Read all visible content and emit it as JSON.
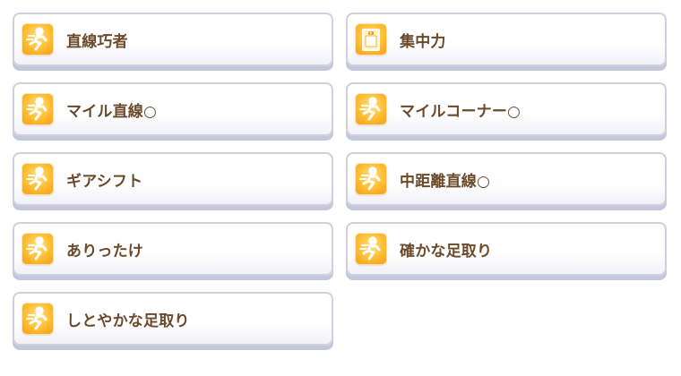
{
  "skills": [
    {
      "label": "直線巧者",
      "icon": "runner-speed-icon"
    },
    {
      "label": "集中力",
      "icon": "starting-gate-icon"
    },
    {
      "label": "マイル直線○",
      "icon": "runner-speed-icon"
    },
    {
      "label": "マイルコーナー○",
      "icon": "runner-speed-icon"
    },
    {
      "label": "ギアシフト",
      "icon": "runner-speed-icon"
    },
    {
      "label": "中距離直線○",
      "icon": "runner-speed-icon"
    },
    {
      "label": "ありったけ",
      "icon": "runner-speed-icon"
    },
    {
      "label": "確かな足取り",
      "icon": "runner-speed-icon"
    },
    {
      "label": "しとやかな足取り",
      "icon": "runner-speed-icon"
    }
  ],
  "colors": {
    "label_text": "#6b4a2c",
    "icon_gold": "#ffc23a",
    "card_border": "#cfcfe0"
  }
}
